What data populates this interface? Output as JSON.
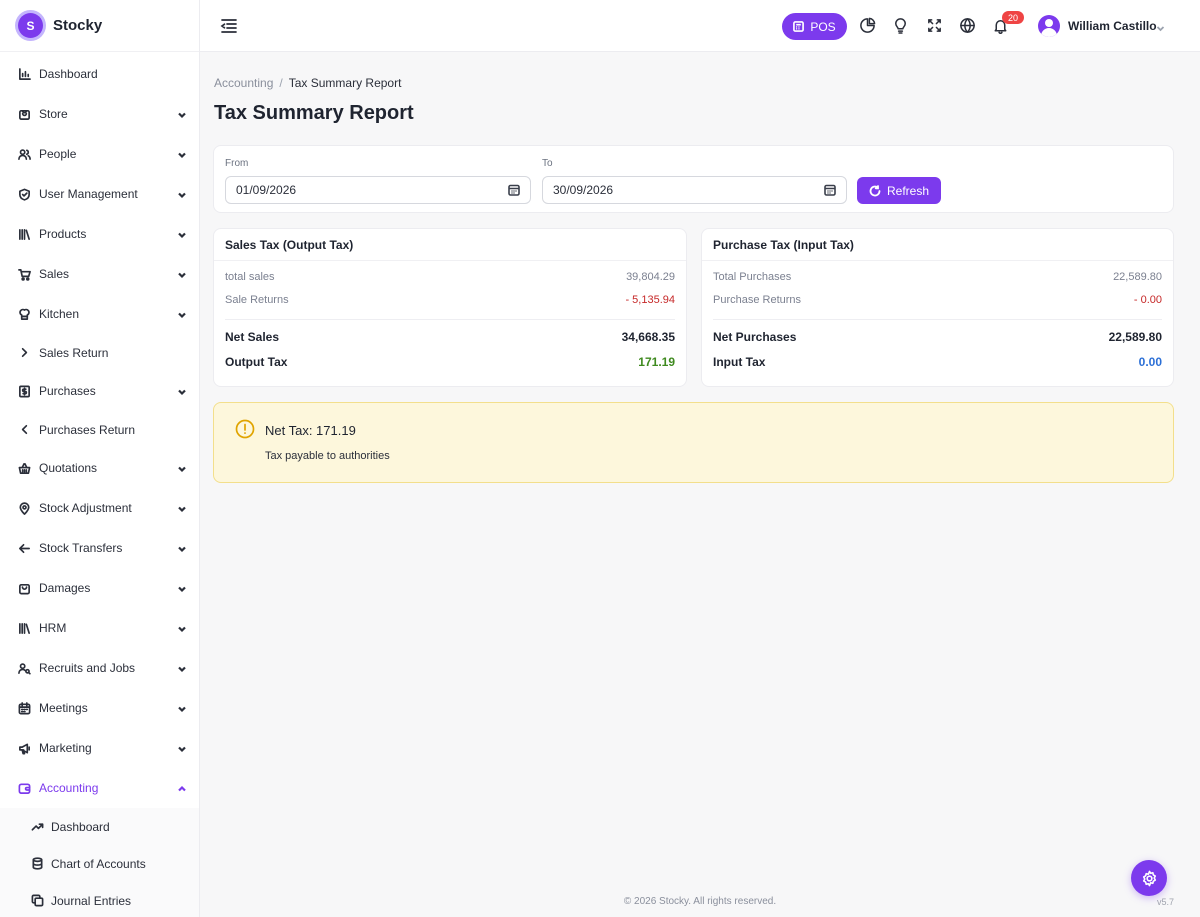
{
  "app": {
    "name": "Stocky",
    "logo_letter": "S"
  },
  "sidebar": {
    "items": [
      {
        "label": "Dashboard",
        "icon": "bar-chart-icon",
        "expandable": false
      },
      {
        "label": "Store",
        "icon": "store-icon",
        "expandable": true
      },
      {
        "label": "People",
        "icon": "users-icon",
        "expandable": true
      },
      {
        "label": "User Management",
        "icon": "shield-icon",
        "expandable": true
      },
      {
        "label": "Products",
        "icon": "books-icon",
        "expandable": true
      },
      {
        "label": "Sales",
        "icon": "cart-icon",
        "expandable": true
      },
      {
        "label": "Kitchen",
        "icon": "chef-hat-icon",
        "expandable": true
      },
      {
        "label": "Sales Return",
        "icon": "chevron-right-icon",
        "expandable": false
      },
      {
        "label": "Purchases",
        "icon": "receipt-icon",
        "expandable": true
      },
      {
        "label": "Purchases Return",
        "icon": "chevron-left-icon",
        "expandable": false
      },
      {
        "label": "Quotations",
        "icon": "basket-icon",
        "expandable": true
      },
      {
        "label": "Stock Adjustment",
        "icon": "map-pin-icon",
        "expandable": true
      },
      {
        "label": "Stock Transfers",
        "icon": "arrow-left-icon",
        "expandable": true
      },
      {
        "label": "Damages",
        "icon": "bag-icon",
        "expandable": true
      },
      {
        "label": "HRM",
        "icon": "library-icon",
        "expandable": true
      },
      {
        "label": "Recruits and Jobs",
        "icon": "user-search-icon",
        "expandable": true
      },
      {
        "label": "Meetings",
        "icon": "calendar-icon",
        "expandable": true
      },
      {
        "label": "Marketing",
        "icon": "megaphone-icon",
        "expandable": true
      },
      {
        "label": "Accounting",
        "icon": "wallet-icon",
        "expandable": true,
        "active": true
      }
    ],
    "accounting_sub": [
      {
        "label": "Dashboard",
        "icon": "trend-icon"
      },
      {
        "label": "Chart of Accounts",
        "icon": "database-icon"
      },
      {
        "label": "Journal Entries",
        "icon": "copy-icon"
      }
    ]
  },
  "topbar": {
    "pos_label": "POS",
    "notification_count": "20",
    "user_name": "William Castillo"
  },
  "breadcrumb": {
    "parent": "Accounting",
    "separator": "/",
    "current": "Tax Summary Report"
  },
  "page_title": "Tax Summary Report",
  "filters": {
    "from_label": "From",
    "from_value": "01/09/2026",
    "to_label": "To",
    "to_value": "30/09/2026",
    "refresh_label": "Refresh"
  },
  "sales_tax": {
    "title": "Sales Tax (Output Tax)",
    "rows": [
      {
        "label": "total sales",
        "value": "39,804.29"
      },
      {
        "label": "Sale Returns",
        "value": "- 5,135.94"
      }
    ],
    "net_label": "Net Sales",
    "net_value": "34,668.35",
    "tax_label": "Output Tax",
    "tax_value": "171.19"
  },
  "purchase_tax": {
    "title": "Purchase Tax (Input Tax)",
    "rows": [
      {
        "label": "Total Purchases",
        "value": "22,589.80"
      },
      {
        "label": "Purchase Returns",
        "value": "- 0.00"
      }
    ],
    "net_label": "Net Purchases",
    "net_value": "22,589.80",
    "tax_label": "Input Tax",
    "tax_value": "0.00"
  },
  "net_tax_alert": {
    "title": "Net Tax: 171.19",
    "message": "Tax payable to authorities"
  },
  "footer": {
    "copyright": "© 2026 Stocky. All rights reserved.",
    "version": "v5.7"
  },
  "colors": {
    "accent": "#7c3aed",
    "negative": "#c62828",
    "output_tax": "#3f8a1f",
    "input_tax": "#2b6fd6",
    "alert_bg": "#fdf7dc"
  }
}
